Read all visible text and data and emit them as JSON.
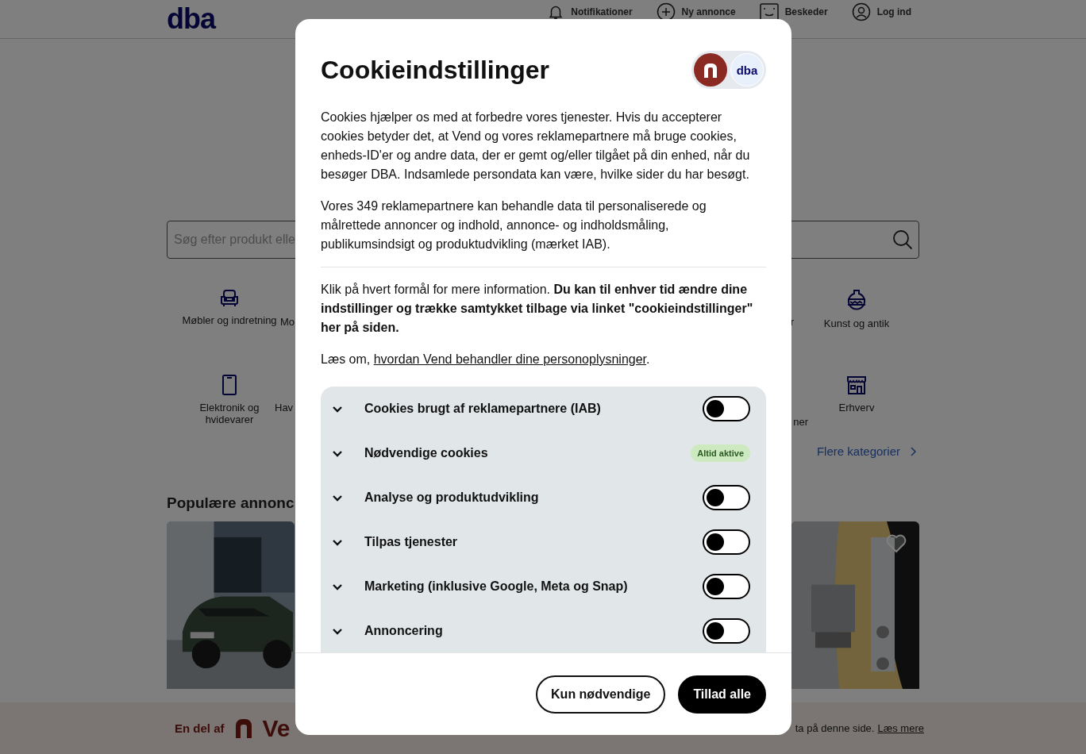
{
  "header": {
    "logo": "dba",
    "nav": [
      {
        "label": "Notifikationer"
      },
      {
        "label": "Ny annonce"
      },
      {
        "label": "Beskeder"
      },
      {
        "label": "Log ind"
      }
    ]
  },
  "search": {
    "placeholder": "Søg efter produkt elle"
  },
  "categories": {
    "rows": [
      {
        "left_items": [
          {
            "label": "Møbler og indretning"
          },
          {
            "label": "Mo"
          }
        ],
        "right_items": [
          {
            "label": "r"
          },
          {
            "label": "Kunst og antik"
          }
        ]
      },
      {
        "left_items": [
          {
            "label": "Elektronik og hvidevarer"
          },
          {
            "label": "Hav"
          }
        ],
        "right_items": [
          {
            "label": "ner"
          },
          {
            "label": "Erhverv"
          }
        ]
      }
    ],
    "more_link": "Flere kategorier"
  },
  "popular": {
    "heading": "Populære annonc",
    "cards": [
      {
        "kind": "picture",
        "favorite": false
      },
      {
        "kind": "picture",
        "favorite": true
      }
    ]
  },
  "footer_bar": {
    "label": "En del af",
    "brand": "Ve",
    "notice": "ta på denne side.",
    "link": "Læs mere"
  },
  "dialog": {
    "title": "Cookieindstillinger",
    "logo": "dba",
    "paragraphs": [
      "Cookies hjælper os med at forbedre vores tjenester. Hvis du accepterer cookies betyder det, at Vend og vores reklamepartnere må bruge cookies, enheds-ID'er og andre data, der er gemt og/eller tilgået på din enhed, når du besøger DBA. Indsamlede persondata kan være, hvilke sider du har besøgt.",
      "Vores 349 reklamepartnere kan behandle data til personaliserede og målrettede annoncer og indhold, annonce- og indholdsmåling, publikumsindsigt og produktudvikling (mærket IAB)."
    ],
    "info": "Klik på hvert formål for mere information. **Du kan til enhver tid ændre dine indstillinger og trække samtykket tilbage via linket \"cookieindstillinger\" her på siden.**",
    "read_prefix": "Læs om,",
    "read_link": "hvordan Vend behandler dine personoplysninger",
    "read_suffix": ".",
    "purposes": [
      {
        "label": "Cookies brugt af reklamepartnere (IAB)",
        "kind": "toggle",
        "on": false,
        "expanded": false
      },
      {
        "label": "Nødvendige cookies",
        "kind": "badge",
        "badge": "Altid aktive",
        "expanded": false
      },
      {
        "label": "Analyse og produktudvikling",
        "kind": "toggle",
        "on": false,
        "expanded": false
      },
      {
        "label": "Tilpas tjenester",
        "kind": "toggle",
        "on": false,
        "expanded": false
      },
      {
        "label": "Marketing (inklusive Google, Meta og Snap)",
        "kind": "toggle",
        "on": false,
        "expanded": false
      },
      {
        "label": "Annoncering",
        "kind": "toggle",
        "on": false,
        "expanded": false
      }
    ],
    "buttons": [
      {
        "label": "Kun nødvendige",
        "kind": "secondary"
      },
      {
        "label": "Tillad alle",
        "kind": "primary"
      }
    ]
  }
}
